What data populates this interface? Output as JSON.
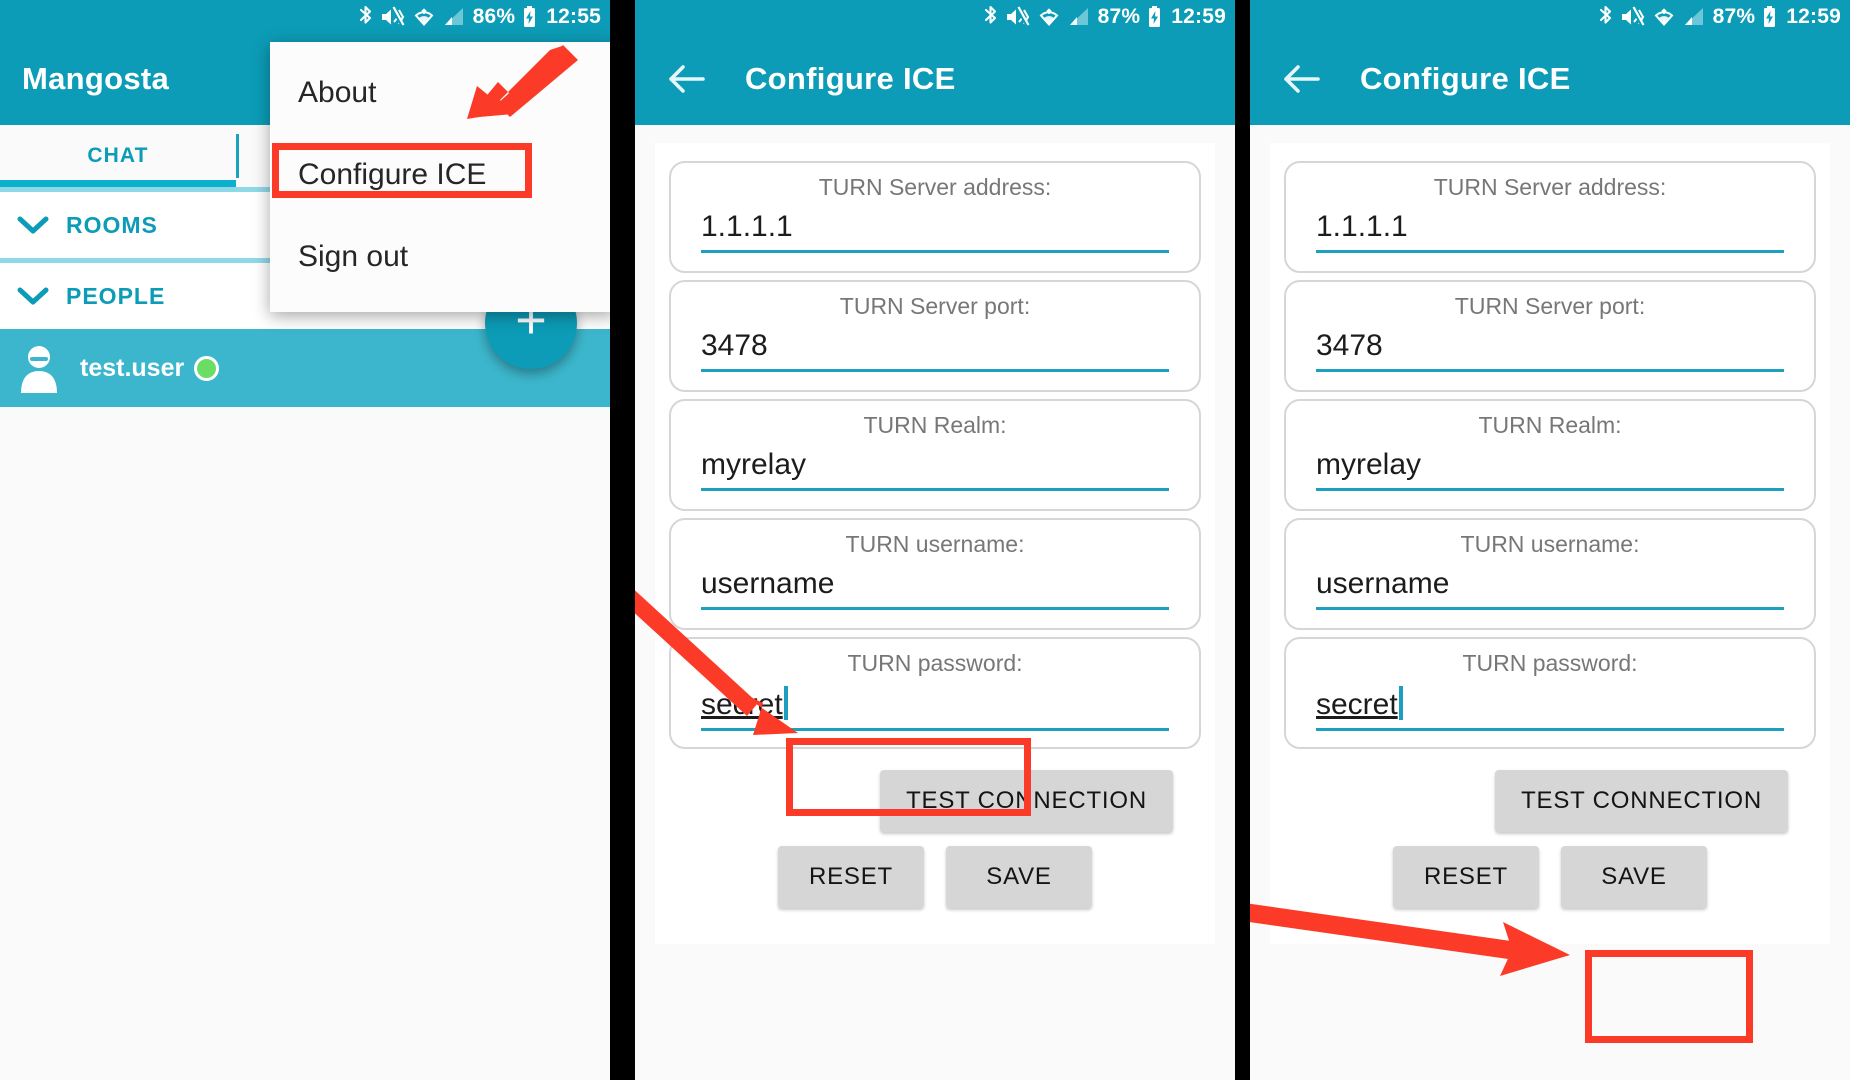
{
  "panels": [
    {
      "id": "panel-chat-list",
      "statusbar": {
        "battery": "86%",
        "time": "12:55",
        "icons": [
          "bluetooth-icon",
          "vibrate-mute-icon",
          "wifi-icon",
          "cellular-signal-icon",
          "battery-charging-icon"
        ]
      },
      "appbar": {
        "title": "Mangosta"
      },
      "tabs": [
        {
          "label": "CHAT",
          "selected": true
        }
      ],
      "sections": [
        {
          "label": "ROOMS"
        },
        {
          "label": "PEOPLE"
        }
      ],
      "contacts": [
        {
          "name": "test.user",
          "presence": "online"
        }
      ],
      "fab": {
        "label": "+"
      },
      "menu": {
        "items": [
          {
            "label": "About",
            "highlighted": false
          },
          {
            "label": "Configure ICE",
            "highlighted": true
          },
          {
            "label": "Sign out",
            "highlighted": false
          }
        ]
      }
    },
    {
      "id": "panel-configure-ice-test",
      "statusbar": {
        "battery": "87%",
        "time": "12:59",
        "icons": [
          "bluetooth-icon",
          "vibrate-mute-icon",
          "wifi-icon",
          "cellular-signal-icon",
          "battery-charging-icon"
        ]
      },
      "appbar": {
        "title": "Configure ICE",
        "back": "back-arrow-icon"
      },
      "fields": [
        {
          "label": "TURN Server address:",
          "value": "1.1.1.1",
          "focused": false
        },
        {
          "label": "TURN Server port:",
          "value": "3478",
          "focused": false
        },
        {
          "label": "TURN Realm:",
          "value": "myrelay",
          "focused": false
        },
        {
          "label": "TURN username:",
          "value": "username",
          "focused": false
        },
        {
          "label": "TURN password:",
          "value": "secret",
          "focused": true
        }
      ],
      "buttons": {
        "test": "TEST CONNECTION",
        "reset": "RESET",
        "save": "SAVE",
        "highlighted": "TEST CONNECTION"
      }
    },
    {
      "id": "panel-configure-ice-save",
      "statusbar": {
        "battery": "87%",
        "time": "12:59",
        "icons": [
          "bluetooth-icon",
          "vibrate-mute-icon",
          "wifi-icon",
          "cellular-signal-icon",
          "battery-charging-icon"
        ]
      },
      "appbar": {
        "title": "Configure ICE",
        "back": "back-arrow-icon"
      },
      "fields": [
        {
          "label": "TURN Server address:",
          "value": "1.1.1.1",
          "focused": false
        },
        {
          "label": "TURN Server port:",
          "value": "3478",
          "focused": false
        },
        {
          "label": "TURN Realm:",
          "value": "myrelay",
          "focused": false
        },
        {
          "label": "TURN username:",
          "value": "username",
          "focused": false
        },
        {
          "label": "TURN password:",
          "value": "secret",
          "focused": true
        }
      ],
      "buttons": {
        "test": "TEST CONNECTION",
        "reset": "RESET",
        "save": "SAVE",
        "highlighted": "SAVE"
      }
    }
  ],
  "colors": {
    "primary": "#0c9cb7",
    "primary_light": "#74d7e8",
    "contact_row": "#3cb6cc",
    "annotation_red": "#fb3b28",
    "presence_online": "#69dd64",
    "field_underline": "#1f9fc0",
    "button_grey": "#d6d6d6"
  }
}
